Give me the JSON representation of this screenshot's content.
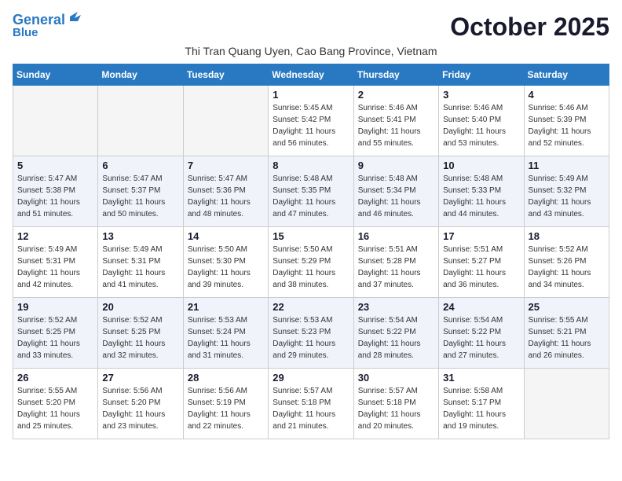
{
  "logo": {
    "line1": "General",
    "line2": "Blue"
  },
  "title": "October 2025",
  "subtitle": "Thi Tran Quang Uyen, Cao Bang Province, Vietnam",
  "weekdays": [
    "Sunday",
    "Monday",
    "Tuesday",
    "Wednesday",
    "Thursday",
    "Friday",
    "Saturday"
  ],
  "weeks": [
    [
      {
        "day": "",
        "info": ""
      },
      {
        "day": "",
        "info": ""
      },
      {
        "day": "",
        "info": ""
      },
      {
        "day": "1",
        "info": "Sunrise: 5:45 AM\nSunset: 5:42 PM\nDaylight: 11 hours\nand 56 minutes."
      },
      {
        "day": "2",
        "info": "Sunrise: 5:46 AM\nSunset: 5:41 PM\nDaylight: 11 hours\nand 55 minutes."
      },
      {
        "day": "3",
        "info": "Sunrise: 5:46 AM\nSunset: 5:40 PM\nDaylight: 11 hours\nand 53 minutes."
      },
      {
        "day": "4",
        "info": "Sunrise: 5:46 AM\nSunset: 5:39 PM\nDaylight: 11 hours\nand 52 minutes."
      }
    ],
    [
      {
        "day": "5",
        "info": "Sunrise: 5:47 AM\nSunset: 5:38 PM\nDaylight: 11 hours\nand 51 minutes."
      },
      {
        "day": "6",
        "info": "Sunrise: 5:47 AM\nSunset: 5:37 PM\nDaylight: 11 hours\nand 50 minutes."
      },
      {
        "day": "7",
        "info": "Sunrise: 5:47 AM\nSunset: 5:36 PM\nDaylight: 11 hours\nand 48 minutes."
      },
      {
        "day": "8",
        "info": "Sunrise: 5:48 AM\nSunset: 5:35 PM\nDaylight: 11 hours\nand 47 minutes."
      },
      {
        "day": "9",
        "info": "Sunrise: 5:48 AM\nSunset: 5:34 PM\nDaylight: 11 hours\nand 46 minutes."
      },
      {
        "day": "10",
        "info": "Sunrise: 5:48 AM\nSunset: 5:33 PM\nDaylight: 11 hours\nand 44 minutes."
      },
      {
        "day": "11",
        "info": "Sunrise: 5:49 AM\nSunset: 5:32 PM\nDaylight: 11 hours\nand 43 minutes."
      }
    ],
    [
      {
        "day": "12",
        "info": "Sunrise: 5:49 AM\nSunset: 5:31 PM\nDaylight: 11 hours\nand 42 minutes."
      },
      {
        "day": "13",
        "info": "Sunrise: 5:49 AM\nSunset: 5:31 PM\nDaylight: 11 hours\nand 41 minutes."
      },
      {
        "day": "14",
        "info": "Sunrise: 5:50 AM\nSunset: 5:30 PM\nDaylight: 11 hours\nand 39 minutes."
      },
      {
        "day": "15",
        "info": "Sunrise: 5:50 AM\nSunset: 5:29 PM\nDaylight: 11 hours\nand 38 minutes."
      },
      {
        "day": "16",
        "info": "Sunrise: 5:51 AM\nSunset: 5:28 PM\nDaylight: 11 hours\nand 37 minutes."
      },
      {
        "day": "17",
        "info": "Sunrise: 5:51 AM\nSunset: 5:27 PM\nDaylight: 11 hours\nand 36 minutes."
      },
      {
        "day": "18",
        "info": "Sunrise: 5:52 AM\nSunset: 5:26 PM\nDaylight: 11 hours\nand 34 minutes."
      }
    ],
    [
      {
        "day": "19",
        "info": "Sunrise: 5:52 AM\nSunset: 5:25 PM\nDaylight: 11 hours\nand 33 minutes."
      },
      {
        "day": "20",
        "info": "Sunrise: 5:52 AM\nSunset: 5:25 PM\nDaylight: 11 hours\nand 32 minutes."
      },
      {
        "day": "21",
        "info": "Sunrise: 5:53 AM\nSunset: 5:24 PM\nDaylight: 11 hours\nand 31 minutes."
      },
      {
        "day": "22",
        "info": "Sunrise: 5:53 AM\nSunset: 5:23 PM\nDaylight: 11 hours\nand 29 minutes."
      },
      {
        "day": "23",
        "info": "Sunrise: 5:54 AM\nSunset: 5:22 PM\nDaylight: 11 hours\nand 28 minutes."
      },
      {
        "day": "24",
        "info": "Sunrise: 5:54 AM\nSunset: 5:22 PM\nDaylight: 11 hours\nand 27 minutes."
      },
      {
        "day": "25",
        "info": "Sunrise: 5:55 AM\nSunset: 5:21 PM\nDaylight: 11 hours\nand 26 minutes."
      }
    ],
    [
      {
        "day": "26",
        "info": "Sunrise: 5:55 AM\nSunset: 5:20 PM\nDaylight: 11 hours\nand 25 minutes."
      },
      {
        "day": "27",
        "info": "Sunrise: 5:56 AM\nSunset: 5:20 PM\nDaylight: 11 hours\nand 23 minutes."
      },
      {
        "day": "28",
        "info": "Sunrise: 5:56 AM\nSunset: 5:19 PM\nDaylight: 11 hours\nand 22 minutes."
      },
      {
        "day": "29",
        "info": "Sunrise: 5:57 AM\nSunset: 5:18 PM\nDaylight: 11 hours\nand 21 minutes."
      },
      {
        "day": "30",
        "info": "Sunrise: 5:57 AM\nSunset: 5:18 PM\nDaylight: 11 hours\nand 20 minutes."
      },
      {
        "day": "31",
        "info": "Sunrise: 5:58 AM\nSunset: 5:17 PM\nDaylight: 11 hours\nand 19 minutes."
      },
      {
        "day": "",
        "info": ""
      }
    ]
  ]
}
